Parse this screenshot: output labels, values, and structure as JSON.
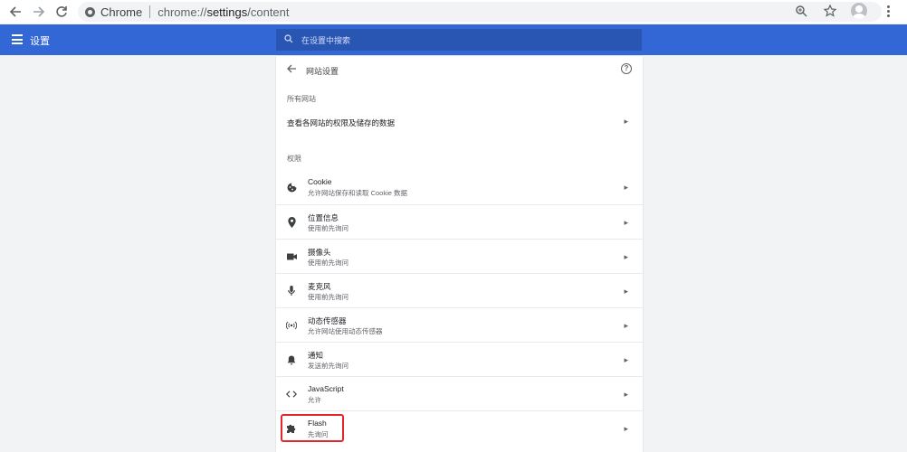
{
  "browser": {
    "site_chip": "Chrome",
    "url_scheme": "chrome://",
    "url_host": "settings",
    "url_path": "/content"
  },
  "header": {
    "title": "设置",
    "search_placeholder": "在设置中搜索"
  },
  "card": {
    "title": "网站设置",
    "all_sites_label": "所有网站",
    "all_sites_row": "查看各网站的权限及储存的数据",
    "permissions_label": "权限",
    "permissions": [
      {
        "title": "Cookie",
        "sub": "允许网站保存和读取 Cookie 数据",
        "icon": "cookie-icon"
      },
      {
        "title": "位置信息",
        "sub": "使用前先询问",
        "icon": "location-icon"
      },
      {
        "title": "摄像头",
        "sub": "使用前先询问",
        "icon": "camera-icon"
      },
      {
        "title": "麦克风",
        "sub": "使用前先询问",
        "icon": "microphone-icon"
      },
      {
        "title": "动态传感器",
        "sub": "允许网站使用动态传感器",
        "icon": "sensor-icon"
      },
      {
        "title": "通知",
        "sub": "发送前先询问",
        "icon": "bell-icon"
      },
      {
        "title": "JavaScript",
        "sub": "允许",
        "icon": "code-icon"
      },
      {
        "title": "Flash",
        "sub": "先询问",
        "icon": "puzzle-icon"
      }
    ]
  },
  "colors": {
    "header_bg": "#3367d6",
    "highlight": "#e3262b"
  }
}
